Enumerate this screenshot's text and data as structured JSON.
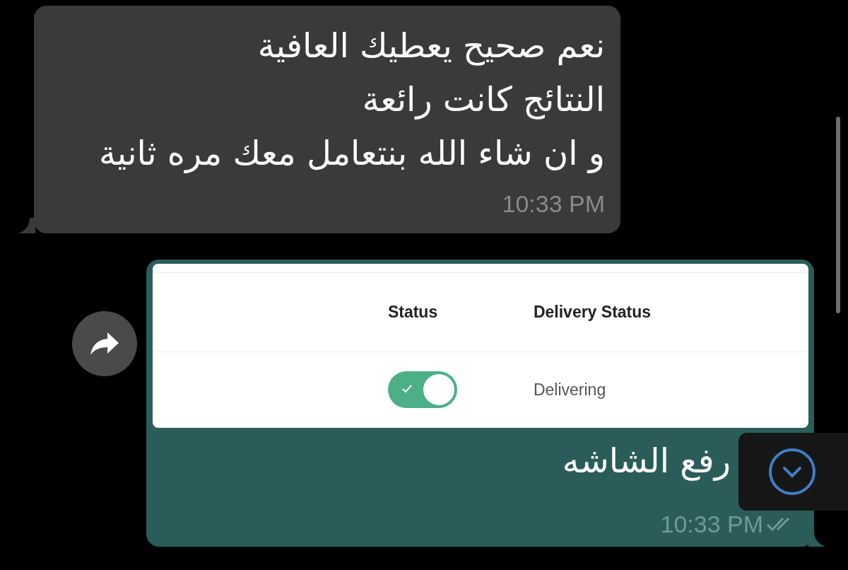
{
  "messages": [
    {
      "kind": "incoming",
      "lines": [
        "نعم صحيح يعطيك العافية",
        "النتائج كانت رائعة",
        "و ان شاء الله بنتعامل معك مره ثانية"
      ],
      "time": "10:33 PM"
    },
    {
      "kind": "outgoing",
      "attachment": {
        "header": {
          "status": "Status",
          "delivery_status": "Delivery Status"
        },
        "rows": [
          {
            "status_on": true,
            "delivery_status": "Delivering"
          }
        ]
      },
      "lines": [
        "رفع الشاشه"
      ],
      "time": "10:33 PM",
      "read": true
    }
  ]
}
